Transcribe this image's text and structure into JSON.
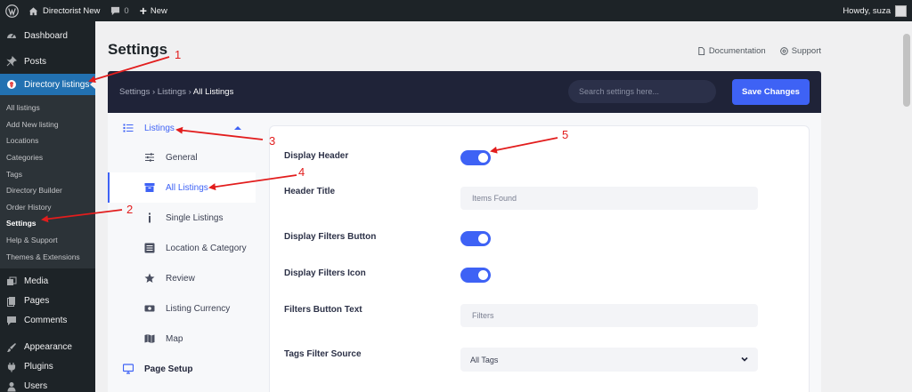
{
  "adminbar": {
    "site_name": "Directorist New",
    "comments_count": "0",
    "new_label": "New",
    "howdy": "Howdy, suza"
  },
  "admin_menu": {
    "items_top": [
      {
        "label": "Dashboard",
        "icon": "dashboard-icon"
      },
      {
        "label": "Posts",
        "icon": "pin-icon"
      }
    ],
    "current": {
      "label": "Directory listings",
      "icon": "map-pin-icon"
    },
    "submenu": [
      "All listings",
      "Add New listing",
      "Locations",
      "Categories",
      "Tags",
      "Directory Builder",
      "Order History",
      "Settings",
      "Help & Support",
      "Themes & Extensions"
    ],
    "submenu_active": "Settings",
    "items_bottom": [
      {
        "label": "Media",
        "icon": "media-icon"
      },
      {
        "label": "Pages",
        "icon": "pages-icon"
      },
      {
        "label": "Comments",
        "icon": "comment-icon"
      },
      {
        "label": "Appearance",
        "icon": "brush-icon"
      },
      {
        "label": "Plugins",
        "icon": "plug-icon"
      },
      {
        "label": "Users",
        "icon": "user-icon"
      }
    ]
  },
  "page": {
    "title": "Settings",
    "documentation": "Documentation",
    "support": "Support"
  },
  "header": {
    "breadcrumb_1": "Settings",
    "breadcrumb_2": "Listings",
    "breadcrumb_current": "All Listings",
    "search_placeholder": "Search settings here...",
    "save_label": "Save Changes"
  },
  "settings_nav": {
    "group": "Listings",
    "items": [
      {
        "label": "General",
        "icon": "sliders-icon"
      },
      {
        "label": "All Listings",
        "icon": "archive-icon"
      },
      {
        "label": "Single Listings",
        "icon": "info-icon"
      },
      {
        "label": "Location & Category",
        "icon": "list-box-icon"
      },
      {
        "label": "Review",
        "icon": "star-icon"
      },
      {
        "label": "Listing Currency",
        "icon": "money-icon"
      },
      {
        "label": "Map",
        "icon": "map-icon"
      }
    ],
    "active": "All Listings",
    "page_setup": "Page Setup"
  },
  "fields": [
    {
      "label": "Display Header",
      "type": "toggle",
      "on": true
    },
    {
      "label": "Header Title",
      "type": "text",
      "value": "Items Found"
    },
    {
      "label": "Display Filters Button",
      "type": "toggle",
      "on": true
    },
    {
      "label": "Display Filters Icon",
      "type": "toggle",
      "on": true
    },
    {
      "label": "Filters Button Text",
      "type": "text",
      "value": "Filters"
    },
    {
      "label": "Tags Filter Source",
      "type": "select",
      "value": "All Tags"
    }
  ],
  "annotations": [
    "1",
    "2",
    "3",
    "4",
    "5"
  ],
  "colors": {
    "accent": "#3e62f5",
    "header_dark": "#1f2338",
    "wp_dark": "#1d2327",
    "wp_blue": "#2271b1",
    "annotation_red": "#e21d1d"
  }
}
